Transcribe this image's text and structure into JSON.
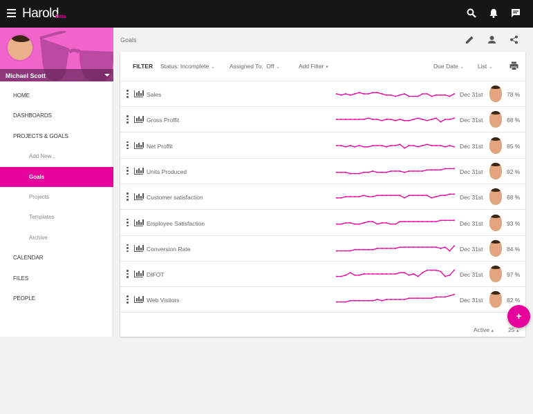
{
  "app": {
    "title": "Harold",
    "badge": "Beta"
  },
  "user": {
    "name": "Michael Scott"
  },
  "nav": [
    {
      "label": "HOME",
      "sub": false
    },
    {
      "label": "DASHBOARDS",
      "sub": false
    },
    {
      "label": "PROJECTS & GOALS",
      "sub": false
    },
    {
      "label": "Add New...",
      "sub": true
    },
    {
      "label": "Goals",
      "sub": true,
      "active": true
    },
    {
      "label": "Projects",
      "sub": true
    },
    {
      "label": "Templates",
      "sub": true
    },
    {
      "label": "Archive",
      "sub": true
    },
    {
      "label": "CALENDAR",
      "sub": false
    },
    {
      "label": "FILES",
      "sub": false
    },
    {
      "label": "PEOPLE",
      "sub": false
    }
  ],
  "breadcrumb": "Goals",
  "filter": {
    "label": "FILTER",
    "status": "Status: Incomplete",
    "assigned_label": "Assigned To:",
    "assigned_value": "Off",
    "add": "Add Filter",
    "sort": "Due Date",
    "view": "List"
  },
  "accent": "#e6009c",
  "goals": [
    {
      "name": "Sales",
      "date": "Dec 31st",
      "pct": "78 %",
      "trend": [
        5,
        4,
        5,
        4,
        5,
        6,
        5,
        5,
        6,
        6,
        5,
        4,
        4,
        3,
        4,
        5,
        3,
        3,
        3,
        5,
        5,
        3,
        4,
        4,
        4,
        3,
        5
      ]
    },
    {
      "name": "Gross Proffit",
      "date": "Dec 31st",
      "pct": "68 %",
      "trend": [
        5,
        5,
        5,
        5,
        5,
        5,
        5,
        6,
        5,
        5,
        4,
        5,
        5,
        4,
        5,
        4,
        4,
        5,
        6,
        5,
        4,
        5,
        6,
        3,
        5,
        5,
        6
      ]
    },
    {
      "name": "Net Proffit",
      "date": "Dec 31st",
      "pct": "85 %",
      "trend": [
        5,
        5,
        4,
        5,
        4,
        5,
        4,
        4,
        5,
        5,
        5,
        4,
        5,
        5,
        6,
        3,
        5,
        5,
        4,
        5,
        6,
        5,
        5,
        5,
        4,
        5,
        4
      ]
    },
    {
      "name": "Units Produced",
      "date": "Dec 31st",
      "pct": "92 %",
      "trend": [
        4,
        4,
        4,
        3,
        3,
        3,
        4,
        4,
        5,
        4,
        4,
        4,
        5,
        5,
        5,
        4,
        5,
        5,
        5,
        5,
        6,
        6,
        6,
        6,
        7,
        7,
        7
      ]
    },
    {
      "name": "Customer satisfaction",
      "date": "Dec 31st",
      "pct": "68 %",
      "trend": [
        4,
        4,
        5,
        5,
        5,
        5,
        6,
        5,
        5,
        6,
        6,
        6,
        6,
        6,
        6,
        4,
        6,
        6,
        6,
        6,
        6,
        4,
        5,
        6,
        6,
        7,
        7
      ]
    },
    {
      "name": "Employee Satisfaction",
      "date": "Dec 31st",
      "pct": "93 %",
      "trend": [
        4,
        4,
        5,
        5,
        4,
        4,
        5,
        6,
        6,
        4,
        5,
        5,
        4,
        4,
        6,
        6,
        6,
        6,
        6,
        6,
        6,
        6,
        6,
        7,
        7,
        7,
        7
      ]
    },
    {
      "name": "Conversion Rate",
      "date": "Dec 31st",
      "pct": "84 %",
      "trend": [
        3,
        3,
        3,
        3,
        4,
        4,
        4,
        4,
        4,
        5,
        5,
        5,
        5,
        5,
        6,
        6,
        6,
        6,
        6,
        6,
        6,
        6,
        6,
        5,
        6,
        3,
        7
      ]
    },
    {
      "name": "DIFOT",
      "date": "Dec 31st",
      "pct": "97 %",
      "trend": [
        3,
        3,
        4,
        6,
        4,
        4,
        5,
        5,
        5,
        5,
        5,
        5,
        5,
        5,
        6,
        6,
        4,
        5,
        3,
        6,
        8,
        8,
        8,
        7,
        3,
        4,
        8
      ]
    },
    {
      "name": "Web Visitors",
      "date": "Dec 31st",
      "pct": "82 %",
      "trend": [
        3,
        3,
        3,
        4,
        4,
        4,
        4,
        4,
        4,
        5,
        4,
        5,
        5,
        5,
        5,
        5,
        6,
        6,
        6,
        6,
        6,
        6,
        7,
        7,
        7,
        8,
        9
      ]
    }
  ],
  "footer": {
    "status": "Active",
    "per_page": "25"
  },
  "fab": "+"
}
